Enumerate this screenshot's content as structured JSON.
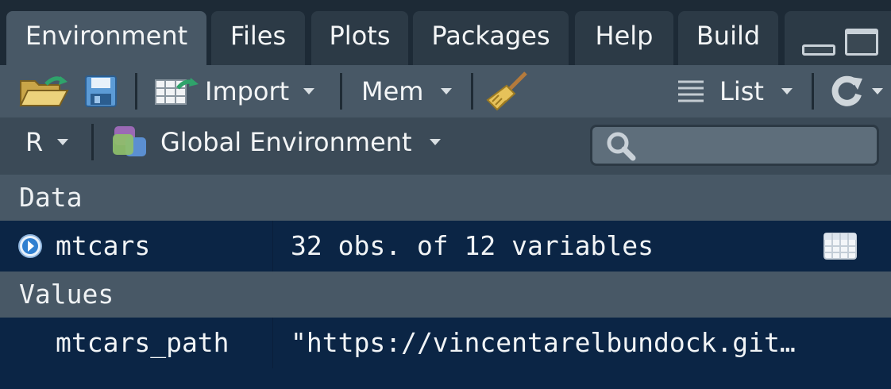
{
  "tabs": [
    "Environment",
    "Files",
    "Plots",
    "Packages",
    "Help",
    "Build"
  ],
  "toolbar": {
    "import_label": "Import",
    "mem_label": "Mem",
    "view_label": "List"
  },
  "env": {
    "language": "R",
    "scope": "Global Environment",
    "search_placeholder": ""
  },
  "sections": {
    "data": "Data",
    "values": "Values"
  },
  "data_rows": [
    {
      "name": "mtcars",
      "value": "32 obs. of 12 variables"
    }
  ],
  "value_rows": [
    {
      "name": "mtcars_path",
      "value": "\"https://vincentarelbundock.git…"
    }
  ],
  "colors": {
    "accent": "#2f7fd0",
    "panel": "#0b2545",
    "header": "#485866"
  }
}
